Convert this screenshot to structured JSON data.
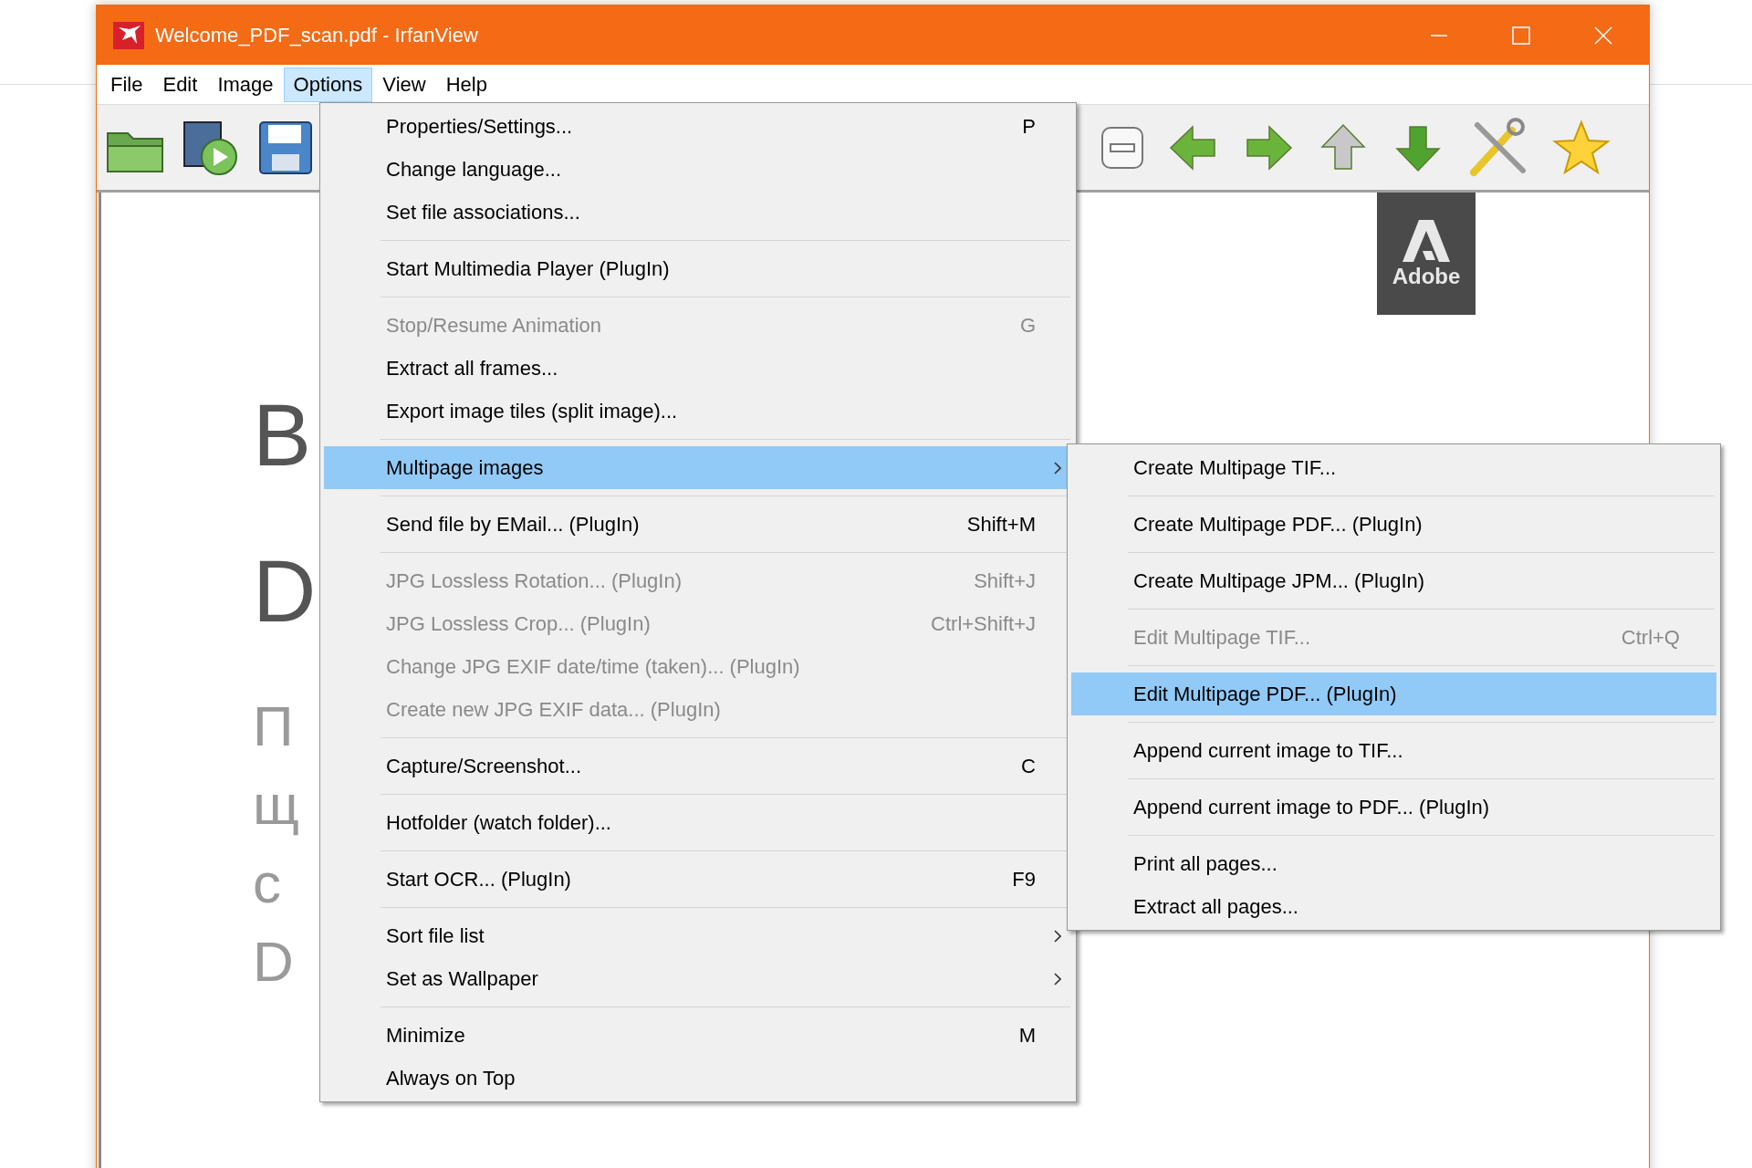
{
  "window": {
    "title": "Welcome_PDF_scan.pdf - IrfanView"
  },
  "menu_bar": [
    {
      "label": "File",
      "selected": false
    },
    {
      "label": "Edit",
      "selected": false
    },
    {
      "label": "Image",
      "selected": false
    },
    {
      "label": "Options",
      "selected": true
    },
    {
      "label": "View",
      "selected": false
    },
    {
      "label": "Help",
      "selected": false
    }
  ],
  "document": {
    "heading_fragments": [
      "B",
      "D"
    ],
    "body_fragments": [
      "П",
      "щ",
      "с",
      "D"
    ],
    "logo_text": "Adobe"
  },
  "options_menu": [
    [
      {
        "label": "Properties/Settings...",
        "shortcut": "P",
        "disabled": false,
        "submenu": false,
        "selected": false
      },
      {
        "label": "Change language...",
        "disabled": false,
        "submenu": false,
        "selected": false
      },
      {
        "label": "Set file associations...",
        "disabled": false,
        "submenu": false,
        "selected": false
      }
    ],
    [
      {
        "label": "Start Multimedia Player (PlugIn)",
        "disabled": false,
        "submenu": false,
        "selected": false
      }
    ],
    [
      {
        "label": "Stop/Resume Animation",
        "shortcut": "G",
        "disabled": true,
        "submenu": false,
        "selected": false
      },
      {
        "label": "Extract all frames...",
        "disabled": false,
        "submenu": false,
        "selected": false
      },
      {
        "label": "Export image tiles (split image)...",
        "disabled": false,
        "submenu": false,
        "selected": false
      }
    ],
    [
      {
        "label": "Multipage images",
        "disabled": false,
        "submenu": true,
        "selected": true
      }
    ],
    [
      {
        "label": "Send file by EMail... (PlugIn)",
        "shortcut": "Shift+M",
        "disabled": false,
        "submenu": false,
        "selected": false
      }
    ],
    [
      {
        "label": "JPG Lossless Rotation... (PlugIn)",
        "shortcut": "Shift+J",
        "disabled": true,
        "submenu": false,
        "selected": false
      },
      {
        "label": "JPG Lossless Crop... (PlugIn)",
        "shortcut": "Ctrl+Shift+J",
        "disabled": true,
        "submenu": false,
        "selected": false
      },
      {
        "label": "Change JPG EXIF date/time (taken)... (PlugIn)",
        "disabled": true,
        "submenu": false,
        "selected": false
      },
      {
        "label": "Create new JPG EXIF data... (PlugIn)",
        "disabled": true,
        "submenu": false,
        "selected": false
      }
    ],
    [
      {
        "label": "Capture/Screenshot...",
        "shortcut": "C",
        "disabled": false,
        "submenu": false,
        "selected": false
      }
    ],
    [
      {
        "label": "Hotfolder (watch folder)...",
        "disabled": false,
        "submenu": false,
        "selected": false
      }
    ],
    [
      {
        "label": "Start OCR... (PlugIn)",
        "shortcut": "F9",
        "disabled": false,
        "submenu": false,
        "selected": false
      }
    ],
    [
      {
        "label": "Sort file list",
        "disabled": false,
        "submenu": true,
        "selected": false
      },
      {
        "label": "Set as Wallpaper",
        "disabled": false,
        "submenu": true,
        "selected": false
      }
    ],
    [
      {
        "label": "Minimize",
        "shortcut": "M",
        "disabled": false,
        "submenu": false,
        "selected": false
      },
      {
        "label": "Always on Top",
        "disabled": false,
        "submenu": false,
        "selected": false
      }
    ]
  ],
  "multipage_submenu": [
    [
      {
        "label": "Create Multipage TIF...",
        "disabled": false,
        "submenu": false,
        "selected": false
      }
    ],
    [
      {
        "label": "Create Multipage PDF... (PlugIn)",
        "disabled": false,
        "submenu": false,
        "selected": false
      }
    ],
    [
      {
        "label": "Create Multipage JPM... (PlugIn)",
        "disabled": false,
        "submenu": false,
        "selected": false
      }
    ],
    [
      {
        "label": "Edit Multipage TIF...",
        "shortcut": "Ctrl+Q",
        "disabled": true,
        "submenu": false,
        "selected": false
      }
    ],
    [
      {
        "label": "Edit Multipage PDF... (PlugIn)",
        "disabled": false,
        "submenu": false,
        "selected": true
      }
    ],
    [
      {
        "label": "Append current image to TIF...",
        "disabled": false,
        "submenu": false,
        "selected": false
      }
    ],
    [
      {
        "label": "Append current image to PDF... (PlugIn)",
        "disabled": false,
        "submenu": false,
        "selected": false
      }
    ],
    [
      {
        "label": "Print all pages...",
        "disabled": false,
        "submenu": false,
        "selected": false
      },
      {
        "label": "Extract all pages...",
        "disabled": false,
        "submenu": false,
        "selected": false
      }
    ]
  ]
}
